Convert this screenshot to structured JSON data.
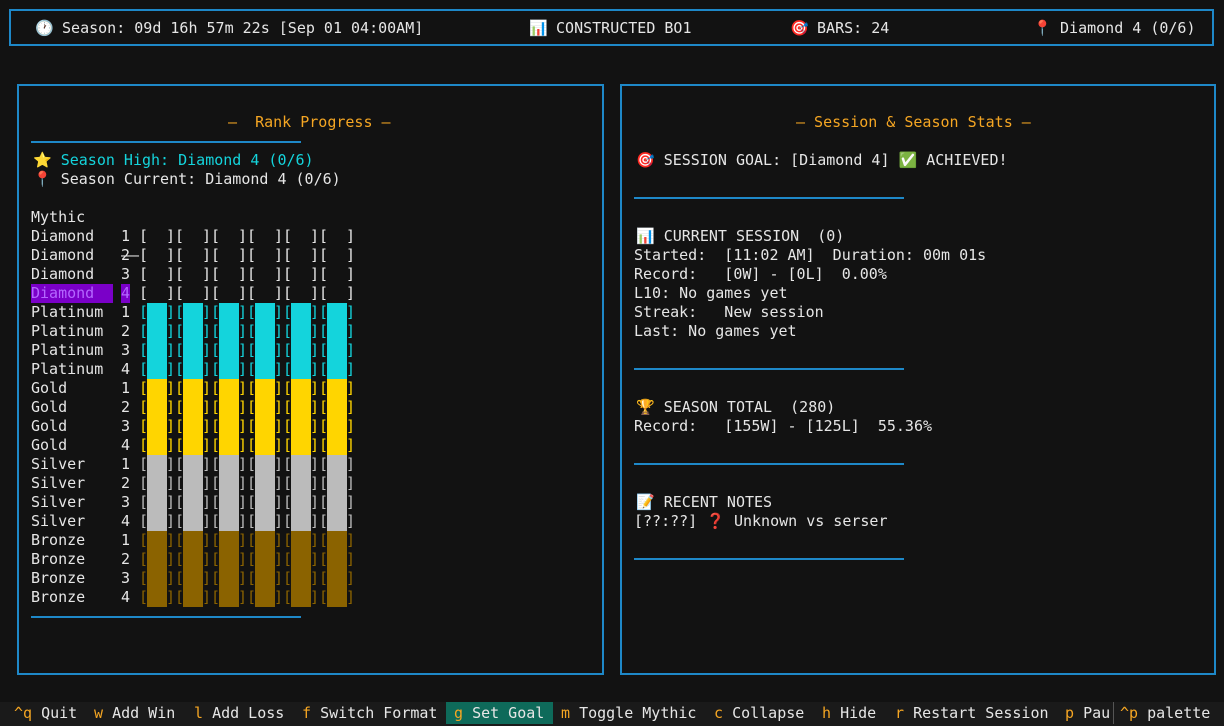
{
  "header": {
    "season": "Season: 09d 16h 57m 22s [Sep 01 04:00AM]",
    "format": "CONSTRUCTED BO1",
    "bars": "BARS: 24",
    "rank": "Diamond 4 (0/6)",
    "icons": [
      "clock-icon",
      "chart-icon",
      "target-icon",
      "pin-icon"
    ]
  },
  "rank_panel": {
    "title": "–  Rank Progress –",
    "season_high": "Season High: Diamond 4 (0/6)",
    "season_current": "Season Current: Diamond 4 (0/6)",
    "mythic_label": "Mythic",
    "mythic_value": "––",
    "rows": [
      {
        "tier": "Diamond",
        "div": "1",
        "fill": "none"
      },
      {
        "tier": "Diamond",
        "div": "2",
        "fill": "none"
      },
      {
        "tier": "Diamond",
        "div": "3",
        "fill": "none"
      },
      {
        "tier": "Diamond",
        "div": "4",
        "fill": "none",
        "current": true
      },
      {
        "tier": "Platinum",
        "div": "1",
        "fill": "plat"
      },
      {
        "tier": "Platinum",
        "div": "2",
        "fill": "plat"
      },
      {
        "tier": "Platinum",
        "div": "3",
        "fill": "plat"
      },
      {
        "tier": "Platinum",
        "div": "4",
        "fill": "plat"
      },
      {
        "tier": "Gold",
        "div": "1",
        "fill": "gold"
      },
      {
        "tier": "Gold",
        "div": "2",
        "fill": "gold"
      },
      {
        "tier": "Gold",
        "div": "3",
        "fill": "gold"
      },
      {
        "tier": "Gold",
        "div": "4",
        "fill": "gold"
      },
      {
        "tier": "Silver",
        "div": "1",
        "fill": "silver"
      },
      {
        "tier": "Silver",
        "div": "2",
        "fill": "silver"
      },
      {
        "tier": "Silver",
        "div": "3",
        "fill": "silver"
      },
      {
        "tier": "Silver",
        "div": "4",
        "fill": "silver"
      },
      {
        "tier": "Bronze",
        "div": "1",
        "fill": "bronze"
      },
      {
        "tier": "Bronze",
        "div": "2",
        "fill": "bronze"
      },
      {
        "tier": "Bronze",
        "div": "3",
        "fill": "bronze"
      },
      {
        "tier": "Bronze",
        "div": "4",
        "fill": "bronze"
      }
    ],
    "colors": {
      "plat": "#14d4dc",
      "gold": "#ffd500",
      "silver": "#bbbbbb",
      "bronze": "#8b6300",
      "empty_bracket": "#e6e6e6",
      "current": "#7a00c8"
    }
  },
  "stats_panel": {
    "title": "– Session & Season Stats –",
    "goal": "SESSION GOAL: [Diamond 4]",
    "goal_status": "ACHIEVED!",
    "current_session": {
      "heading": "CURRENT SESSION  (0)",
      "started": "Started:  [11:02 AM]  Duration: 00m 01s",
      "record": "Record:   [0W] - [0L]  0.00%",
      "l10": "L10: No games yet",
      "streak": "Streak:   New session",
      "last": "Last: No games yet"
    },
    "season_total": {
      "heading": "SEASON TOTAL  (280)",
      "record": "Record:   [155W] - [125L]  55.36%"
    },
    "notes": {
      "heading": "RECENT NOTES",
      "items": [
        "[??:??] ❓ Unknown vs serser"
      ]
    }
  },
  "footer": {
    "items": [
      {
        "key": "^q",
        "label": "Quit"
      },
      {
        "key": "w",
        "label": "Add Win"
      },
      {
        "key": "l",
        "label": "Add Loss"
      },
      {
        "key": "f",
        "label": "Switch Format"
      },
      {
        "key": "g",
        "label": "Set Goal",
        "active": true
      },
      {
        "key": "m",
        "label": "Toggle Mythic"
      },
      {
        "key": "c",
        "label": "Collapse"
      },
      {
        "key": "h",
        "label": "Hide"
      },
      {
        "key": "r",
        "label": "Restart Session"
      },
      {
        "key": "p",
        "label": "Pau"
      }
    ],
    "palette": {
      "key": "^p",
      "label": "palette"
    }
  }
}
